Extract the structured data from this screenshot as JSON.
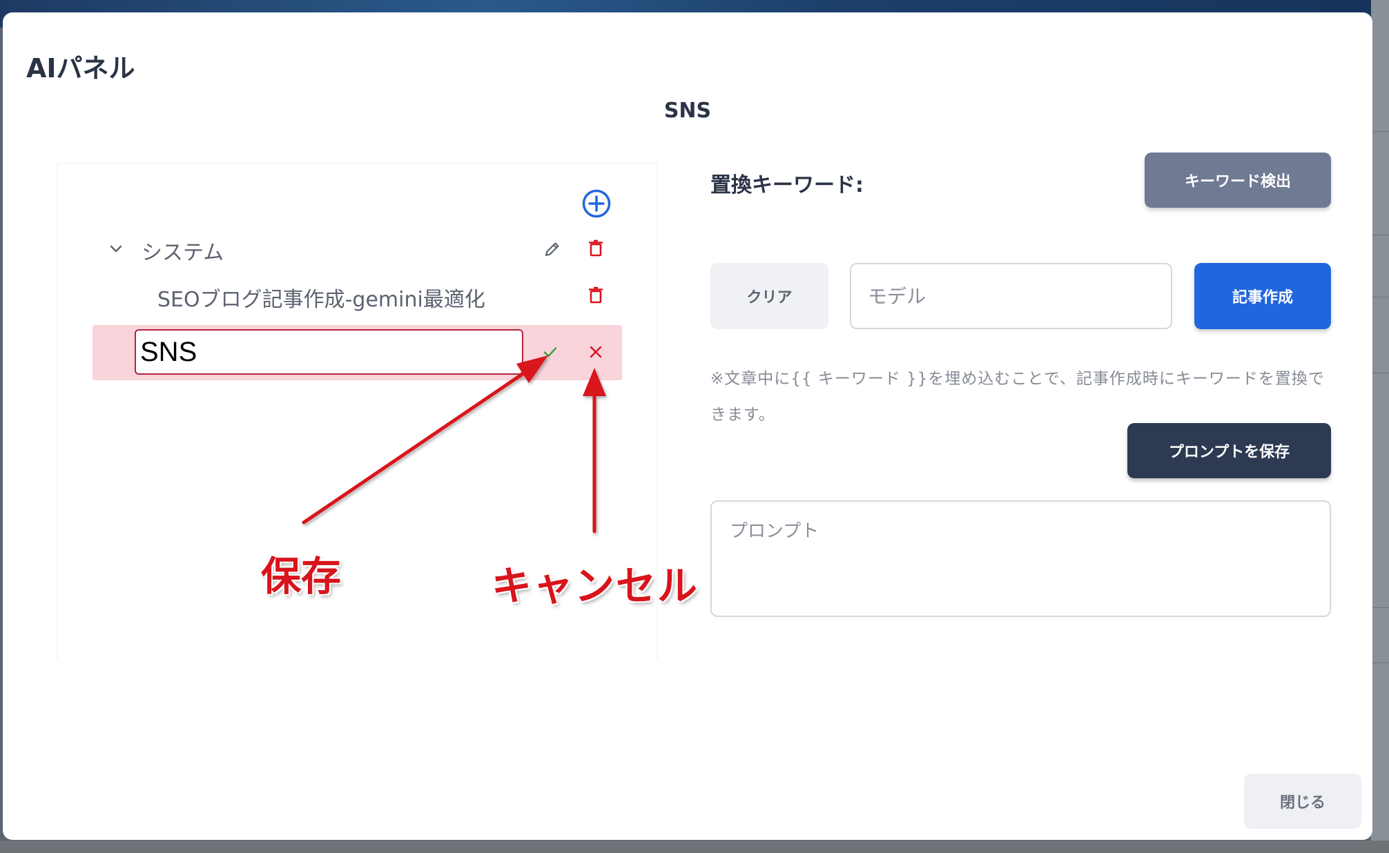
{
  "modal": {
    "title": "AIパネル",
    "prompt_title": "SNS"
  },
  "tree": {
    "folder_label": "システム",
    "child_label": "SEOブログ記事作成-gemini最適化",
    "edit_input_value": "SNS"
  },
  "annotations": {
    "save": "保存",
    "cancel": "キャンセル"
  },
  "right_panel": {
    "keyword_label": "置換キーワード:",
    "detect_button": "キーワード検出",
    "clear_button": "クリア",
    "model_placeholder": "モデル",
    "create_button": "記事作成",
    "note": "※文章中に{{ キーワード }}を埋め込むことで、記事作成時にキーワードを置換できます。",
    "save_prompt_button": "プロンプトを保存",
    "prompt_placeholder": "プロンプト"
  },
  "footer": {
    "close_button": "閉じる"
  },
  "colors": {
    "primary": "#2266dd",
    "dark": "#2d3a52",
    "danger": "#d8141c",
    "selected_row": "#f9d4da",
    "success": "#3a9a3a"
  },
  "icons": [
    "plus-circle-icon",
    "chevron-down-icon",
    "pencil-icon",
    "trash-icon",
    "check-icon",
    "close-icon"
  ]
}
